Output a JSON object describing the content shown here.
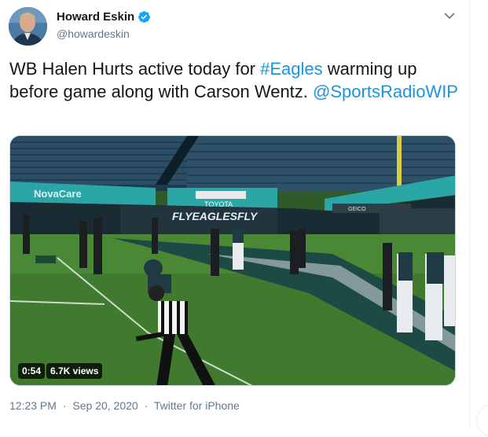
{
  "author": {
    "name": "Howard Eskin",
    "handle": "@howardeskin",
    "verified": true
  },
  "tweet": {
    "text_pre": "WB Halen Hurts active today for ",
    "hashtag": "#Eagles",
    "text_post": " warming up before game along with Carson Wentz. ",
    "mention": "@SportsRadioWIP"
  },
  "video": {
    "duration": "0:54",
    "views": "6.7K views"
  },
  "meta": {
    "time": "12:23 PM",
    "separator": "·",
    "date": "Sep 20, 2020",
    "source": "Twitter for iPhone"
  },
  "scene_text": {
    "banner_left": "NovaCare",
    "banner_mid": "TOYOTA",
    "fly_eagles": "FLYEAGLESFLY",
    "geico": "GEICO"
  },
  "colors": {
    "link": "#1b95e0",
    "verified": "#1da1f2",
    "muted": "#657786"
  }
}
